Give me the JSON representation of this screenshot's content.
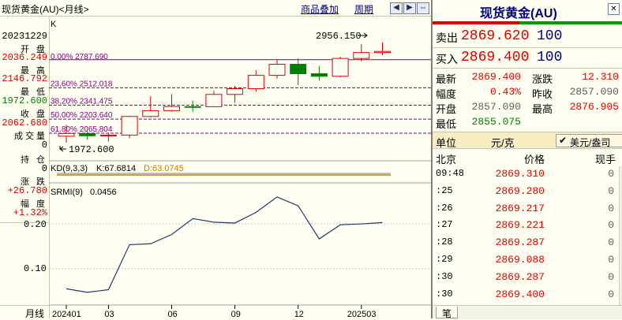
{
  "header": {
    "title": "现货黄金(AU)<月线>",
    "links": [
      "商品叠加",
      "周期"
    ],
    "nav_icons": [
      "left-arrow",
      "right-arrow",
      "swap-arrows"
    ]
  },
  "left_info": {
    "date": "20231229",
    "open_label": "开 盘",
    "open": "2036.249",
    "high_label": "最 高",
    "high": "2146.792",
    "low_label": "最 低",
    "low": "1972.600",
    "close_label": "收 盘",
    "close": "2062.680",
    "volume_label": "成交量",
    "volume": "0",
    "oi_label": "持 仓",
    "oi": "0",
    "change_label": "涨 跌",
    "change": "+26.780",
    "pct_label": "幅 度",
    "pct": "+1.32%",
    "bottom_label": "月线"
  },
  "chart": {
    "corner_label": "K",
    "fib_levels": [
      {
        "label": "0.00%  2787.690",
        "value": 2787.69
      },
      {
        "label": "23.60%  2512.018",
        "value": 2512.018
      },
      {
        "label": "38.20%  2341.475",
        "value": 2341.475
      },
      {
        "label": "50.00%  2203.640",
        "value": 2203.64
      },
      {
        "label": "61.80%  2065.804",
        "value": 2065.804
      }
    ],
    "max_annotation": "2956.150",
    "min_annotation": "1972.600",
    "kd_label": "KD(9,3,3)",
    "kd_k": "K:67.6814",
    "kd_d": "D:63.0745",
    "srmi_label": "SRMI(9)",
    "srmi_value": "0.0456",
    "srmi_ticks": [
      "0.20",
      "0.10"
    ],
    "x_labels": [
      "202401",
      "03",
      "06",
      "09",
      "12",
      "202503"
    ]
  },
  "chart_data": {
    "type": "candlestick",
    "candles": [
      {
        "o": 2036.2,
        "h": 2146.8,
        "l": 1972.6,
        "c": 2062.7
      },
      {
        "o": 2062.7,
        "h": 2088.0,
        "l": 2002.0,
        "c": 2040.0
      },
      {
        "o": 2040.0,
        "h": 2070.0,
        "l": 1984.0,
        "c": 2047.0
      },
      {
        "o": 2047.0,
        "h": 2235.0,
        "l": 2016.0,
        "c": 2230.0
      },
      {
        "o": 2230.0,
        "h": 2430.0,
        "l": 2222.0,
        "c": 2287.0
      },
      {
        "o": 2287.0,
        "h": 2450.0,
        "l": 2277.0,
        "c": 2327.0
      },
      {
        "o": 2327.0,
        "h": 2387.0,
        "l": 2277.0,
        "c": 2326.0
      },
      {
        "o": 2326.0,
        "h": 2483.0,
        "l": 2320.0,
        "c": 2447.0
      },
      {
        "o": 2447.0,
        "h": 2531.0,
        "l": 2364.0,
        "c": 2503.0
      },
      {
        "o": 2503.0,
        "h": 2685.0,
        "l": 2471.0,
        "c": 2634.0
      },
      {
        "o": 2634.0,
        "h": 2790.0,
        "l": 2603.0,
        "c": 2743.0
      },
      {
        "o": 2743.0,
        "h": 2801.0,
        "l": 2536.0,
        "c": 2650.0
      },
      {
        "o": 2650.0,
        "h": 2726.0,
        "l": 2583.0,
        "c": 2625.0
      },
      {
        "o": 2625.0,
        "h": 2817.0,
        "l": 2615.0,
        "c": 2800.0
      },
      {
        "o": 2800.0,
        "h": 2942.0,
        "l": 2772.0,
        "c": 2858.0
      },
      {
        "o": 2858.0,
        "h": 2956.15,
        "l": 2832.0,
        "c": 2869.4
      }
    ],
    "srmi": [
      0.035,
      0.027,
      0.033,
      0.135,
      0.137,
      0.158,
      0.194,
      0.186,
      0.184,
      0.208,
      0.243,
      0.223,
      0.148,
      0.18,
      0.182,
      0.185
    ],
    "srmi_ylim": [
      0.0,
      0.25
    ],
    "price_ylim": [
      1972.6,
      2956.15
    ],
    "x_ticks": [
      {
        "index": 0,
        "label": "202401"
      },
      {
        "index": 2,
        "label": "03"
      },
      {
        "index": 5,
        "label": "06"
      },
      {
        "index": 8,
        "label": "09"
      },
      {
        "index": 11,
        "label": "12"
      },
      {
        "index": 14,
        "label": "202503"
      }
    ]
  },
  "quote": {
    "title": "现货黄金(AU)",
    "sell_label": "卖出",
    "sell_price": "2869.620",
    "sell_qty": "100",
    "buy_label": "买入",
    "buy_price": "2869.400",
    "buy_qty": "100",
    "stats": [
      {
        "l1": "最新",
        "v1": "2869.400",
        "c1": "red",
        "l2": "涨跌",
        "v2": "12.310",
        "c2": "red"
      },
      {
        "l1": "幅度",
        "v1": "0.43%",
        "c1": "red",
        "l2": "昨收",
        "v2": "2857.090",
        "c2": "gray"
      },
      {
        "l1": "开盘",
        "v1": "2857.090",
        "c1": "gray",
        "l2": "最高",
        "v2": "2876.905",
        "c2": "red"
      },
      {
        "l1": "最低",
        "v1": "2855.075",
        "c1": "green",
        "l2": "",
        "v2": "",
        "c2": "gray"
      }
    ],
    "unit_label": "单位",
    "unit_value": "元/克",
    "unit_option": "美元/盎司",
    "ticks_header": [
      "北京",
      "价格",
      "现手"
    ],
    "ticks": [
      {
        "time": "09:48",
        "price": "2869.310",
        "vol": "0"
      },
      {
        "time": ":25",
        "price": "2869.280",
        "vol": "0"
      },
      {
        "time": ":26",
        "price": "2869.217",
        "vol": "0"
      },
      {
        "time": ":27",
        "price": "2869.221",
        "vol": "0"
      },
      {
        "time": ":28",
        "price": "2869.287",
        "vol": "0"
      },
      {
        "time": ":29",
        "price": "2869.088",
        "vol": "0"
      },
      {
        "time": ":30",
        "price": "2869.287",
        "vol": "0"
      },
      {
        "time": ":30",
        "price": "2869.400",
        "vol": "0"
      }
    ],
    "bottom_tab": "笔"
  },
  "colors": {
    "up": "#e00000",
    "down": "#008000",
    "fib": "#800080",
    "grid": "#c0c0c0"
  }
}
